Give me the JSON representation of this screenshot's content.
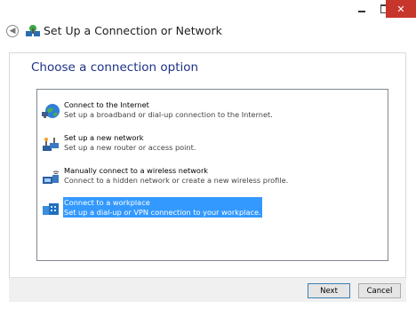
{
  "window": {
    "title": "Set Up a Connection or Network"
  },
  "main": {
    "heading": "Choose a connection option"
  },
  "options": [
    {
      "title": "Connect to the Internet",
      "desc": "Set up a broadband or dial-up connection to the Internet.",
      "icon": "globe-network-icon"
    },
    {
      "title": "Set up a new network",
      "desc": "Set up a new router or access point.",
      "icon": "router-network-icon"
    },
    {
      "title": "Manually connect to a wireless network",
      "desc": "Connect to a hidden network or create a new wireless profile.",
      "icon": "wireless-network-icon"
    },
    {
      "title": "Connect to a workplace",
      "desc": "Set up a dial-up or VPN connection to your workplace.",
      "icon": "workplace-vpn-icon",
      "selected": true
    }
  ],
  "footer": {
    "next_label": "Next",
    "cancel_label": "Cancel"
  },
  "colors": {
    "selection": "#3399ff",
    "heading": "#1e3287",
    "close": "#c7362b"
  }
}
